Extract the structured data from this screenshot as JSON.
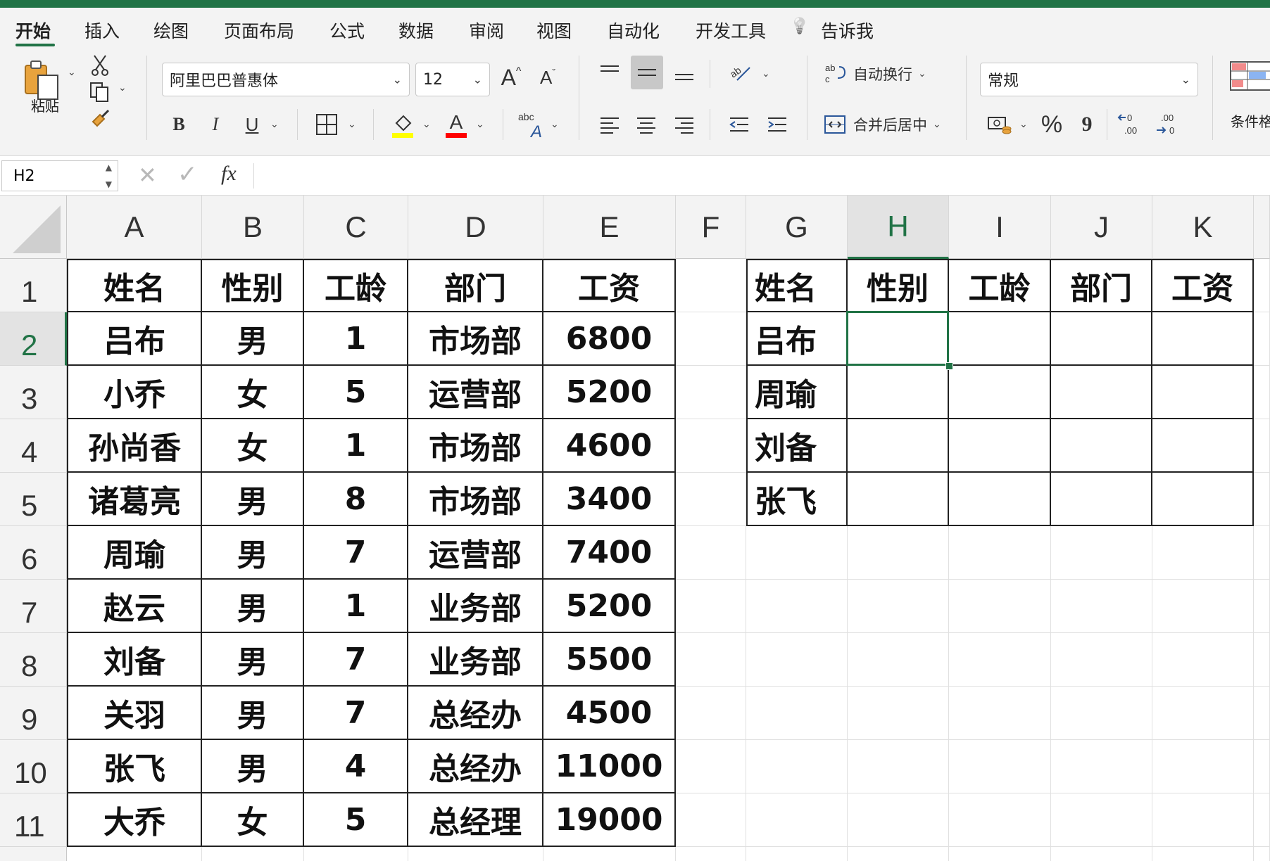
{
  "tabs": [
    "开始",
    "插入",
    "绘图",
    "页面布局",
    "公式",
    "数据",
    "审阅",
    "视图",
    "自动化",
    "开发工具",
    "告诉我"
  ],
  "ribbon": {
    "paste_label": "粘贴",
    "font_name": "阿里巴巴普惠体",
    "font_size": "12",
    "grow_font": "A",
    "shrink_font": "A",
    "bold": "B",
    "italic": "I",
    "underline": "U",
    "font_color_glyph": "A",
    "wrap_text": "自动换行",
    "merge_center": "合并后居中",
    "number_format": "常规",
    "percent": "%",
    "comma": "9",
    "cond_format": "条件格",
    "accent_color": "#217346",
    "fill_color": "#ffff00",
    "font_color": "#ff0000"
  },
  "formula_bar": {
    "name_box": "H2",
    "fx": "fx",
    "formula": ""
  },
  "sheet": {
    "columns": [
      "A",
      "B",
      "C",
      "D",
      "E",
      "F",
      "G",
      "H",
      "I",
      "J",
      "K"
    ],
    "rows": [
      "1",
      "2",
      "3",
      "4",
      "5",
      "6",
      "7",
      "8",
      "9",
      "10",
      "11"
    ],
    "selected_cell": "H2",
    "table1": {
      "headers": [
        "姓名",
        "性别",
        "工龄",
        "部门",
        "工资"
      ],
      "rows": [
        [
          "吕布",
          "男",
          "1",
          "市场部",
          "6800"
        ],
        [
          "小乔",
          "女",
          "5",
          "运营部",
          "5200"
        ],
        [
          "孙尚香",
          "女",
          "1",
          "市场部",
          "4600"
        ],
        [
          "诸葛亮",
          "男",
          "8",
          "市场部",
          "3400"
        ],
        [
          "周瑜",
          "男",
          "7",
          "运营部",
          "7400"
        ],
        [
          "赵云",
          "男",
          "1",
          "业务部",
          "5200"
        ],
        [
          "刘备",
          "男",
          "7",
          "业务部",
          "5500"
        ],
        [
          "关羽",
          "男",
          "7",
          "总经办",
          "4500"
        ],
        [
          "张飞",
          "男",
          "4",
          "总经办",
          "11000"
        ],
        [
          "大乔",
          "女",
          "5",
          "总经理",
          "19000"
        ]
      ]
    },
    "table2": {
      "headers": [
        "姓名",
        "性别",
        "工龄",
        "部门",
        "工资"
      ],
      "names": [
        "吕布",
        "周瑜",
        "刘备",
        "张飞"
      ]
    }
  }
}
